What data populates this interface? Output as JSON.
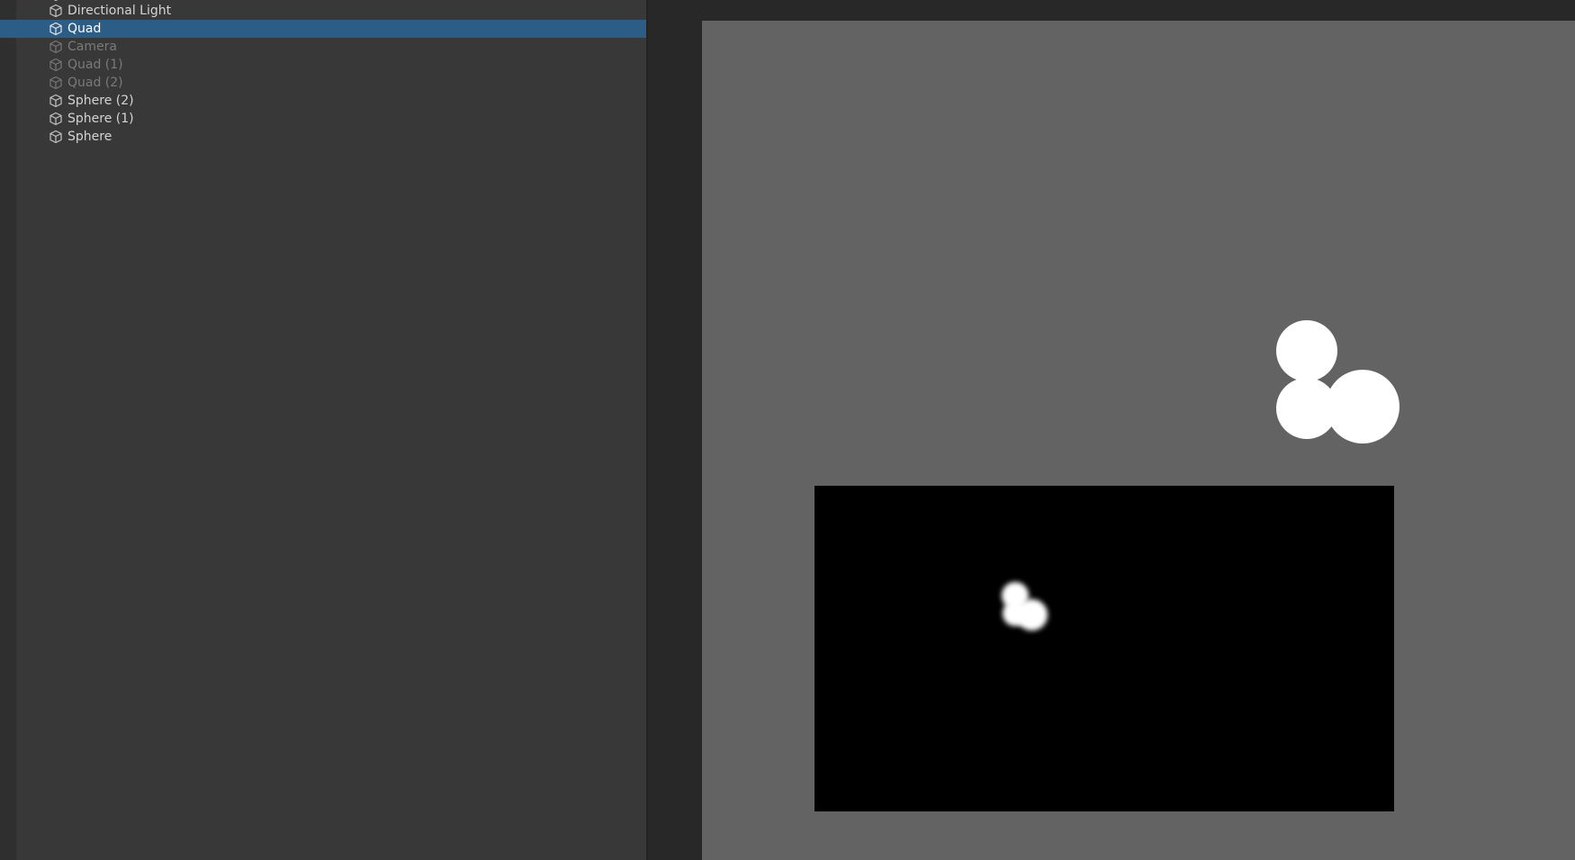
{
  "hierarchy": {
    "partial_item": {
      "label": "",
      "icon": "gameobject-cube-icon"
    },
    "items": [
      {
        "label": "Directional Light",
        "icon": "gameobject-cube-icon",
        "state": "active"
      },
      {
        "label": "Quad",
        "icon": "gameobject-cube-icon",
        "state": "selected"
      },
      {
        "label": "Camera",
        "icon": "gameobject-cube-icon",
        "state": "inactive"
      },
      {
        "label": "Quad (1)",
        "icon": "gameobject-cube-icon",
        "state": "inactive"
      },
      {
        "label": "Quad (2)",
        "icon": "gameobject-cube-icon",
        "state": "inactive"
      },
      {
        "label": "Sphere (2)",
        "icon": "gameobject-cube-icon",
        "state": "active"
      },
      {
        "label": "Sphere (1)",
        "icon": "gameobject-cube-icon",
        "state": "active"
      },
      {
        "label": "Sphere",
        "icon": "gameobject-cube-icon",
        "state": "active"
      }
    ]
  },
  "colors": {
    "panel_background": "#383838",
    "selection": "#2c5d87",
    "viewport_background": "#636363",
    "quad_surface": "#000000",
    "sphere": "#ffffff",
    "text": "#d4d4d4",
    "text_inactive": "#7a7a7a"
  }
}
